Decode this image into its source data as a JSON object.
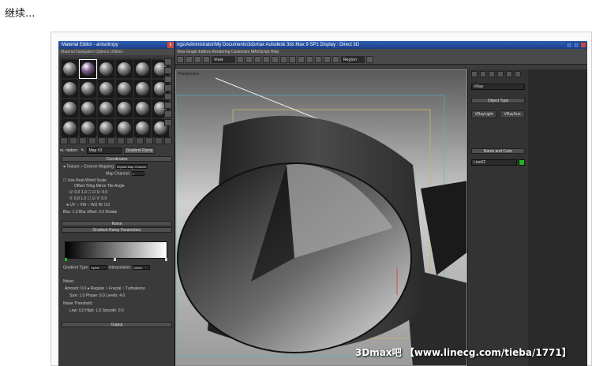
{
  "post_text": "继续...",
  "material_editor": {
    "title": "Material Editor - anisotropy",
    "menu": "Material  Navigation  Options  Utilities",
    "close": "x",
    "map_label": "m. ntation:",
    "map_name": "Map #3",
    "map_type": "Gradient Ramp",
    "rollouts": {
      "coordinates": "Coordinates",
      "noise": "Noise",
      "gradient_ramp": "Gradient Ramp Parameters",
      "output": "Output"
    },
    "params": {
      "texture_row": "● Texture  ○ Environ  Mapping:",
      "mapping_value": "Explicit Map Channel",
      "map_channel_label": "Map Channel:",
      "map_channel_value": "1",
      "realworld": "☐ Use Real-World Scale",
      "offset_header": "Offset        Tiling        Mirror Tile         Angle",
      "u_row": "U: 0.0        1.0          ☐  ☑    U: 0.0",
      "v_row": "V: 0.0        1.0          ☐  ☑    V: 0.0",
      "uv_row": "● UV  ○ VW  ○ WU                     W: 0.0",
      "blur_row": "Blur: 1.0     Blur offset: 0.0          Rotate",
      "gradient_type_label": "Gradient Type:",
      "gradient_type_value": "Spiral",
      "interpolation_label": "Interpolation:",
      "interpolation_value": "Linear",
      "noise_label": "Noise:",
      "amount_row": "Amount: 0.0      ● Regular  ○ Fractal  ○ Turbulence",
      "size_row": "Size: 1.0        Phase: 0.0        Levels: 4.0",
      "threshold_label": "Noise Threshold:",
      "threshold_row": "Low: 0.0      High: 1.0      Smooth: 0.0"
    },
    "colors": {
      "title_bar": "#2d5fb2",
      "panel": "#3a3a3a",
      "ramp_flag": "#1fb41f"
    }
  },
  "main_window": {
    "title": "ngs\\Administrator\\My Documents\\3dsmax       Autodesk 3ds Max 9 SP1        Display : Direct 3D",
    "menu": "View   Graph Editors   Rendering   Customize   MAXScript   Help",
    "view_dropdown": "View",
    "region_dropdown": "Region",
    "viewport_label": "Perspective",
    "command_panel": {
      "renderer_dropdown": "VRay",
      "object_type": "Object Type",
      "btn_light": "VRayLight",
      "btn_sun": "VRaySun",
      "name_and_color": "Name and Color",
      "name_value": "Line02"
    },
    "colors": {
      "title_bar": "#2d5fb2",
      "object_color": "#1fb41f"
    }
  },
  "watermark": "3Dmax吧 【www.linecg.com/tieba/1771】"
}
